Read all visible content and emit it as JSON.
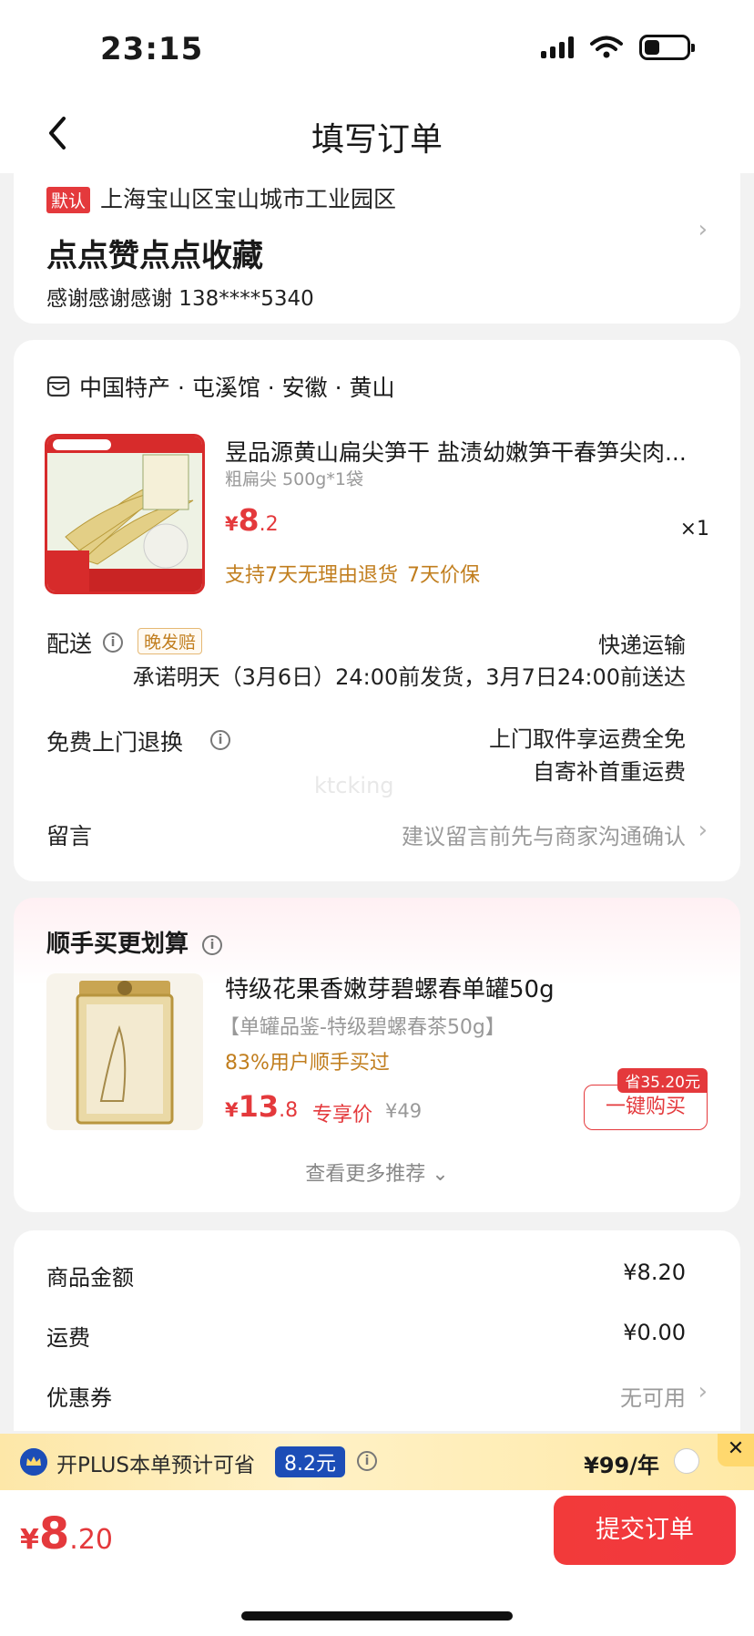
{
  "status_bar": {
    "time": "23:15"
  },
  "nav": {
    "title": "填写订单"
  },
  "address": {
    "default_tag": "默认",
    "line": "上海宝山区宝山城市工业园区",
    "name": "点点赞点点收藏",
    "contact": "感谢感谢感谢  138****5340"
  },
  "order": {
    "shop": "中国特产 · 屯溪馆 · 安徽 · 黄山",
    "product": {
      "title": "昱品源黄山扁尖笋干 盐渍幼嫩笋干春笋尖肉...",
      "spec": "粗扁尖 500g*1袋",
      "currency": "¥",
      "price_int": "8",
      "price_dec": ".2",
      "qty": "×1",
      "promise_1": "支持7天无理由退货",
      "promise_2": "7天价保"
    },
    "delivery": {
      "label": "配送",
      "tag": "晚发赔",
      "method": "快递运输",
      "promise": "承诺明天（3月6日）24:00前发货，3月7日24:00前送达"
    },
    "return": {
      "label": "免费上门退换",
      "line1": "上门取件享运费全免",
      "line2": "自寄补首重运费"
    },
    "note": {
      "label": "留言",
      "placeholder": "建议留言前先与商家沟通确认"
    },
    "watermark": "ktcking"
  },
  "recommend": {
    "title": "顺手买更划算",
    "name": "特级花果香嫩芽碧螺春单罐50g",
    "sub": "【单罐品鉴-特级碧螺春茶50g】",
    "bought": "83%用户顺手买过",
    "currency": "¥",
    "price_int": "13",
    "price_dec": ".8",
    "exclusive": "专享价",
    "orig_price": "¥49",
    "save_tag": "省35.20元",
    "buy_label": "一键购买",
    "more": "查看更多推荐"
  },
  "summary": {
    "goods_label": "商品金额",
    "goods_value": "¥8.20",
    "shipping_label": "运费",
    "shipping_value": "¥0.00",
    "coupon_label": "优惠券",
    "coupon_value": "无可用"
  },
  "plus": {
    "text": "开PLUS本单预计可省",
    "amount": "8.2元",
    "price": "¥99/年"
  },
  "bottom": {
    "currency": "¥",
    "total_int": "8",
    "total_dec": ".20",
    "submit": "提交订单"
  },
  "colors": {
    "accent_red": "#e4393c",
    "gold": "#c17e1e",
    "plus_blue": "#1c4db7"
  }
}
